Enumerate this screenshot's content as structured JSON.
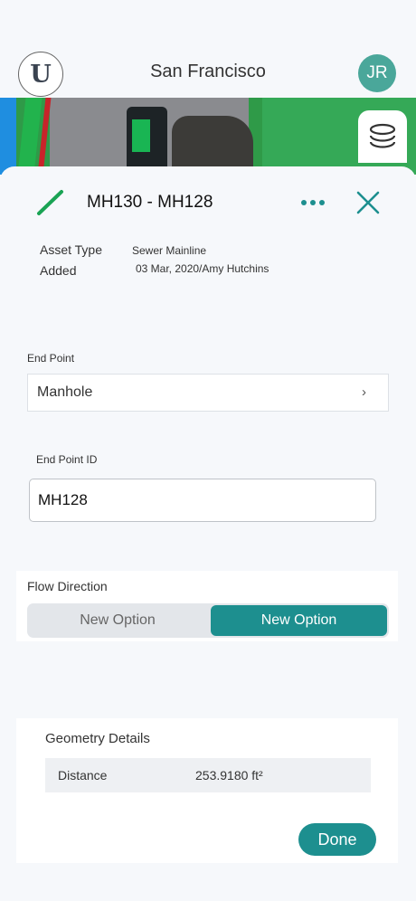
{
  "header": {
    "logo_letter": "U",
    "city": "San Francisco",
    "avatar_initials": "JR"
  },
  "asset": {
    "title": "MH130 - MH128",
    "asset_type_label": "Asset Type",
    "asset_type_value": "Sewer Mainline",
    "added_label": "Added",
    "added_value": "03 Mar, 2020/Amy Hutchins"
  },
  "form": {
    "end_point_label": "End Point",
    "end_point_value": "Manhole",
    "end_point_id_label": "End Point ID",
    "end_point_id_value": "MH128"
  },
  "flow": {
    "label": "Flow Direction",
    "options": [
      "New Option",
      "New Option"
    ],
    "selected_index": 1
  },
  "geometry": {
    "title": "Geometry Details",
    "distance_label": "Distance",
    "distance_value": "253.9180 ft²"
  },
  "actions": {
    "done_label": "Done"
  },
  "icons": {
    "edit": "pencil-line-icon",
    "more": "more-dots-icon",
    "close": "close-icon",
    "layers": "layers-icon",
    "chevron": "chevron-right-icon"
  },
  "colors": {
    "accent": "#1d8f8f",
    "avatar": "#4aa79a",
    "edit_line": "#1aa354"
  }
}
